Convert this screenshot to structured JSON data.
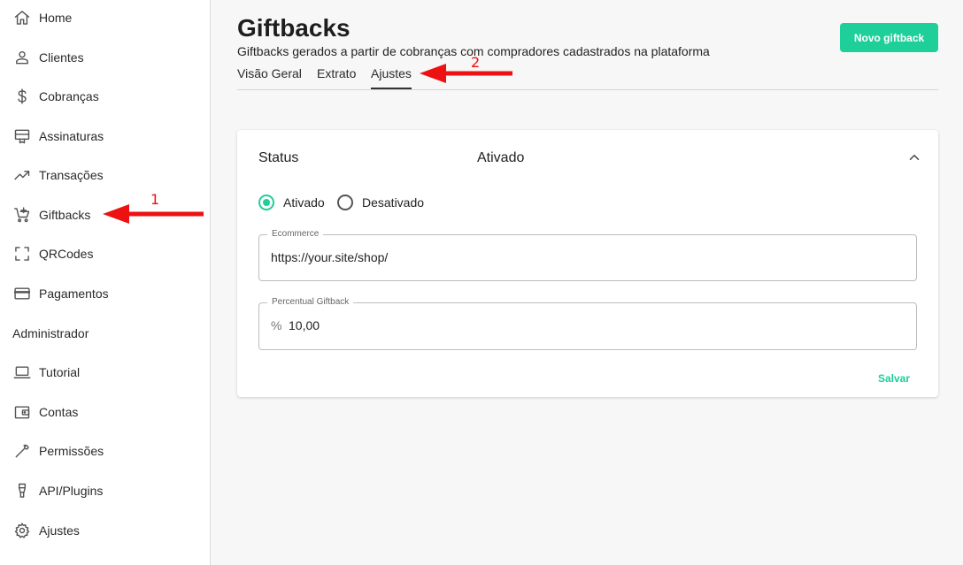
{
  "sidebar": {
    "items": [
      {
        "label": "Home",
        "icon": "home-icon"
      },
      {
        "label": "Clientes",
        "icon": "person-icon"
      },
      {
        "label": "Cobranças",
        "icon": "dollar-icon"
      },
      {
        "label": "Assinaturas",
        "icon": "card-stand-icon"
      },
      {
        "label": "Transações",
        "icon": "trending-up-icon"
      },
      {
        "label": "Giftbacks",
        "icon": "cart-plus-icon"
      },
      {
        "label": "QRCodes",
        "icon": "scan-frame-icon"
      },
      {
        "label": "Pagamentos",
        "icon": "credit-card-icon"
      }
    ],
    "section_title": "Administrador",
    "admin_items": [
      {
        "label": "Tutorial",
        "icon": "laptop-icon"
      },
      {
        "label": "Contas",
        "icon": "wallet-icon"
      },
      {
        "label": "Permissões",
        "icon": "wrench-icon"
      },
      {
        "label": "API/Plugins",
        "icon": "plug-icon"
      },
      {
        "label": "Ajustes",
        "icon": "gear-icon"
      }
    ]
  },
  "header": {
    "title": "Giftbacks",
    "subtitle": "Giftbacks gerados a partir de cobranças com compradores cadastrados na plataforma",
    "new_button": "Novo giftback"
  },
  "tabs": [
    {
      "label": "Visão Geral",
      "active": false
    },
    {
      "label": "Extrato",
      "active": false
    },
    {
      "label": "Ajustes",
      "active": true
    }
  ],
  "card": {
    "status_label": "Status",
    "status_value": "Ativado",
    "options": [
      {
        "label": "Ativado",
        "checked": true
      },
      {
        "label": "Desativado",
        "checked": false
      }
    ],
    "ecommerce": {
      "label": "Ecommerce",
      "value": "https://your.site/shop/"
    },
    "percent": {
      "label": "Percentual Giftback",
      "prefix": "%",
      "value": "10,00"
    },
    "save_label": "Salvar"
  },
  "annotations": [
    {
      "number": "1",
      "target": "Giftbacks"
    },
    {
      "number": "2",
      "target": "Ajustes"
    }
  ],
  "colors": {
    "accent": "#1ecf9a",
    "annotation": "#ee1111",
    "sidebar_bg": "#ffffff",
    "page_bg": "#f7f7f7"
  }
}
